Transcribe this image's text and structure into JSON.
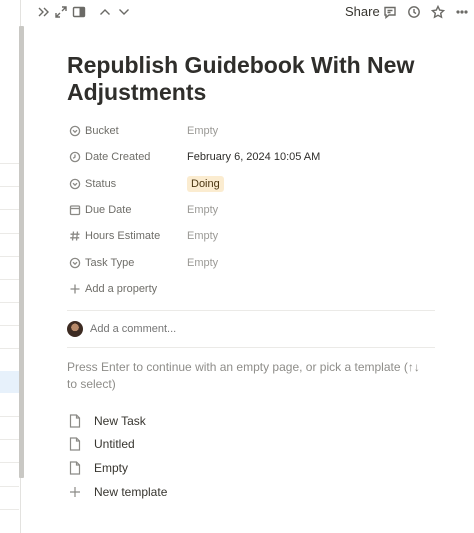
{
  "topbar": {
    "share_label": "Share",
    "icons": [
      "double-chevron-right-icon",
      "expand-icon",
      "side-peek-icon",
      "chevron-up-icon",
      "chevron-down-icon",
      "comment-icon",
      "history-clock-icon",
      "star-icon",
      "more-icon"
    ]
  },
  "page": {
    "title": "Republish Guidebook With New Adjustments"
  },
  "properties": [
    {
      "name": "Bucket",
      "icon": "select-icon",
      "value": "Empty",
      "empty": true
    },
    {
      "name": "Date Created",
      "icon": "clock-icon",
      "value": "February 6, 2024 10:05 AM",
      "empty": false
    },
    {
      "name": "Status",
      "icon": "status-icon",
      "value": "Doing",
      "badge_color": "#fbecd0"
    },
    {
      "name": "Due Date",
      "icon": "calendar-icon",
      "value": "Empty",
      "empty": true
    },
    {
      "name": "Hours Estimate",
      "icon": "hash-icon",
      "value": "Empty",
      "empty": true
    },
    {
      "name": "Task Type",
      "icon": "select-icon",
      "value": "Empty",
      "empty": true
    }
  ],
  "add_property_label": "Add a property",
  "comment": {
    "placeholder": "Add a comment..."
  },
  "hint_text": "Press Enter to continue with an empty page, or pick a template (↑↓ to select)",
  "templates": [
    {
      "label": "New Task",
      "icon": "page-icon"
    },
    {
      "label": "Untitled",
      "icon": "page-icon"
    },
    {
      "label": "Empty",
      "icon": "page-icon"
    },
    {
      "label": "New template",
      "icon": "plus-icon"
    }
  ]
}
